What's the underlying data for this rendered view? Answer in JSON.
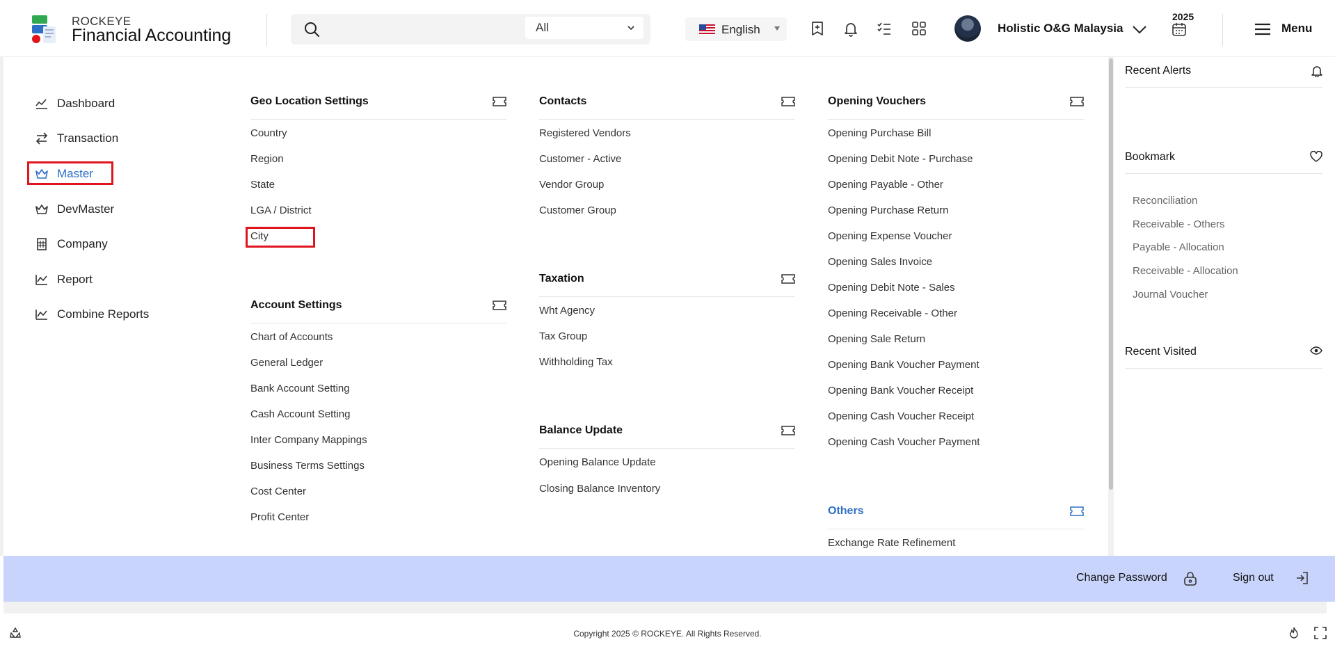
{
  "header": {
    "brand_small": "ROCKEYE",
    "brand_big": "Financial Accounting",
    "search": {
      "placeholder": "",
      "scope": "All"
    },
    "language": "English",
    "company": "Holistic O&G Malaysia",
    "year": "2025",
    "menu_label": "Menu"
  },
  "sidebar": {
    "items": [
      {
        "label": "Dashboard",
        "icon": "trend-chart-icon"
      },
      {
        "label": "Transaction",
        "icon": "swap-arrows-icon"
      },
      {
        "label": "Master",
        "icon": "crown-icon",
        "active": true
      },
      {
        "label": "DevMaster",
        "icon": "crown-icon"
      },
      {
        "label": "Company",
        "icon": "building-icon"
      },
      {
        "label": "Report",
        "icon": "report-chart-icon"
      },
      {
        "label": "Combine Reports",
        "icon": "report-chart-icon"
      }
    ]
  },
  "menu": {
    "geo": {
      "title": "Geo Location Settings",
      "items": [
        "Country",
        "Region",
        "State",
        "LGA / District",
        "City"
      ]
    },
    "account": {
      "title": "Account Settings",
      "items": [
        "Chart of Accounts",
        "General Ledger",
        "Bank Account Setting",
        "Cash Account Setting",
        "Inter Company Mappings",
        "Business Terms Settings",
        "Cost Center",
        "Profit Center"
      ]
    },
    "contacts": {
      "title": "Contacts",
      "items": [
        "Registered Vendors",
        "Customer - Active",
        "Vendor Group",
        "Customer Group"
      ]
    },
    "taxation": {
      "title": "Taxation",
      "items": [
        "Wht Agency",
        "Tax Group",
        "Withholding Tax"
      ]
    },
    "balance": {
      "title": "Balance Update",
      "items": [
        "Opening Balance Update",
        "Closing Balance Inventory"
      ]
    },
    "opening": {
      "title": "Opening Vouchers",
      "items": [
        "Opening Purchase Bill",
        "Opening Debit Note - Purchase",
        "Opening Payable - Other",
        "Opening Purchase Return",
        "Opening Expense Voucher",
        "Opening Sales Invoice",
        "Opening Debit Note - Sales",
        "Opening Receivable - Other",
        "Opening Sale Return",
        "Opening Bank Voucher Payment",
        "Opening Bank Voucher Receipt",
        "Opening Cash Voucher Receipt",
        "Opening Cash Voucher Payment"
      ]
    },
    "others": {
      "title": "Others",
      "items": [
        "Exchange Rate Refinement"
      ]
    }
  },
  "right_panel": {
    "recent_alerts": "Recent Alerts",
    "bookmark": "Bookmark",
    "bookmarks": [
      "Reconciliation",
      "Receivable - Others",
      "Payable - Allocation",
      "Receivable - Allocation",
      "Journal Voucher"
    ],
    "recent_visited": "Recent Visited"
  },
  "footer": {
    "change_password": "Change Password",
    "sign_out": "Sign out",
    "copyright": "Copyright 2025 © ROCKEYE. All Rights Reserved."
  },
  "colors": {
    "accent": "#2d6fc6",
    "highlight": "#e0141b",
    "footer_bar": "#c8d4fb"
  }
}
